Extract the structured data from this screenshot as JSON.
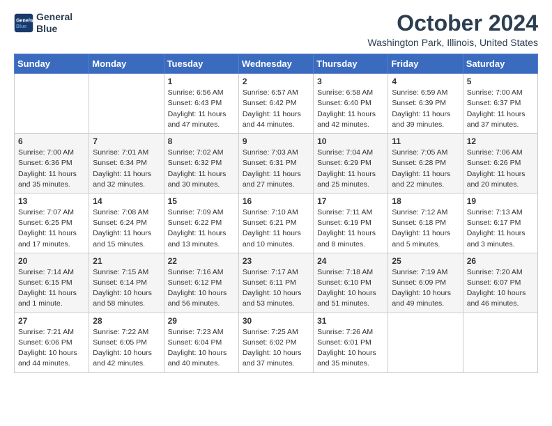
{
  "logo": {
    "line1": "General",
    "line2": "Blue"
  },
  "title": "October 2024",
  "location": "Washington Park, Illinois, United States",
  "days_of_week": [
    "Sunday",
    "Monday",
    "Tuesday",
    "Wednesday",
    "Thursday",
    "Friday",
    "Saturday"
  ],
  "weeks": [
    [
      {
        "day": "",
        "info": ""
      },
      {
        "day": "",
        "info": ""
      },
      {
        "day": "1",
        "info": "Sunrise: 6:56 AM\nSunset: 6:43 PM\nDaylight: 11 hours and 47 minutes."
      },
      {
        "day": "2",
        "info": "Sunrise: 6:57 AM\nSunset: 6:42 PM\nDaylight: 11 hours and 44 minutes."
      },
      {
        "day": "3",
        "info": "Sunrise: 6:58 AM\nSunset: 6:40 PM\nDaylight: 11 hours and 42 minutes."
      },
      {
        "day": "4",
        "info": "Sunrise: 6:59 AM\nSunset: 6:39 PM\nDaylight: 11 hours and 39 minutes."
      },
      {
        "day": "5",
        "info": "Sunrise: 7:00 AM\nSunset: 6:37 PM\nDaylight: 11 hours and 37 minutes."
      }
    ],
    [
      {
        "day": "6",
        "info": "Sunrise: 7:00 AM\nSunset: 6:36 PM\nDaylight: 11 hours and 35 minutes."
      },
      {
        "day": "7",
        "info": "Sunrise: 7:01 AM\nSunset: 6:34 PM\nDaylight: 11 hours and 32 minutes."
      },
      {
        "day": "8",
        "info": "Sunrise: 7:02 AM\nSunset: 6:32 PM\nDaylight: 11 hours and 30 minutes."
      },
      {
        "day": "9",
        "info": "Sunrise: 7:03 AM\nSunset: 6:31 PM\nDaylight: 11 hours and 27 minutes."
      },
      {
        "day": "10",
        "info": "Sunrise: 7:04 AM\nSunset: 6:29 PM\nDaylight: 11 hours and 25 minutes."
      },
      {
        "day": "11",
        "info": "Sunrise: 7:05 AM\nSunset: 6:28 PM\nDaylight: 11 hours and 22 minutes."
      },
      {
        "day": "12",
        "info": "Sunrise: 7:06 AM\nSunset: 6:26 PM\nDaylight: 11 hours and 20 minutes."
      }
    ],
    [
      {
        "day": "13",
        "info": "Sunrise: 7:07 AM\nSunset: 6:25 PM\nDaylight: 11 hours and 17 minutes."
      },
      {
        "day": "14",
        "info": "Sunrise: 7:08 AM\nSunset: 6:24 PM\nDaylight: 11 hours and 15 minutes."
      },
      {
        "day": "15",
        "info": "Sunrise: 7:09 AM\nSunset: 6:22 PM\nDaylight: 11 hours and 13 minutes."
      },
      {
        "day": "16",
        "info": "Sunrise: 7:10 AM\nSunset: 6:21 PM\nDaylight: 11 hours and 10 minutes."
      },
      {
        "day": "17",
        "info": "Sunrise: 7:11 AM\nSunset: 6:19 PM\nDaylight: 11 hours and 8 minutes."
      },
      {
        "day": "18",
        "info": "Sunrise: 7:12 AM\nSunset: 6:18 PM\nDaylight: 11 hours and 5 minutes."
      },
      {
        "day": "19",
        "info": "Sunrise: 7:13 AM\nSunset: 6:17 PM\nDaylight: 11 hours and 3 minutes."
      }
    ],
    [
      {
        "day": "20",
        "info": "Sunrise: 7:14 AM\nSunset: 6:15 PM\nDaylight: 11 hours and 1 minute."
      },
      {
        "day": "21",
        "info": "Sunrise: 7:15 AM\nSunset: 6:14 PM\nDaylight: 10 hours and 58 minutes."
      },
      {
        "day": "22",
        "info": "Sunrise: 7:16 AM\nSunset: 6:12 PM\nDaylight: 10 hours and 56 minutes."
      },
      {
        "day": "23",
        "info": "Sunrise: 7:17 AM\nSunset: 6:11 PM\nDaylight: 10 hours and 53 minutes."
      },
      {
        "day": "24",
        "info": "Sunrise: 7:18 AM\nSunset: 6:10 PM\nDaylight: 10 hours and 51 minutes."
      },
      {
        "day": "25",
        "info": "Sunrise: 7:19 AM\nSunset: 6:09 PM\nDaylight: 10 hours and 49 minutes."
      },
      {
        "day": "26",
        "info": "Sunrise: 7:20 AM\nSunset: 6:07 PM\nDaylight: 10 hours and 46 minutes."
      }
    ],
    [
      {
        "day": "27",
        "info": "Sunrise: 7:21 AM\nSunset: 6:06 PM\nDaylight: 10 hours and 44 minutes."
      },
      {
        "day": "28",
        "info": "Sunrise: 7:22 AM\nSunset: 6:05 PM\nDaylight: 10 hours and 42 minutes."
      },
      {
        "day": "29",
        "info": "Sunrise: 7:23 AM\nSunset: 6:04 PM\nDaylight: 10 hours and 40 minutes."
      },
      {
        "day": "30",
        "info": "Sunrise: 7:25 AM\nSunset: 6:02 PM\nDaylight: 10 hours and 37 minutes."
      },
      {
        "day": "31",
        "info": "Sunrise: 7:26 AM\nSunset: 6:01 PM\nDaylight: 10 hours and 35 minutes."
      },
      {
        "day": "",
        "info": ""
      },
      {
        "day": "",
        "info": ""
      }
    ]
  ]
}
